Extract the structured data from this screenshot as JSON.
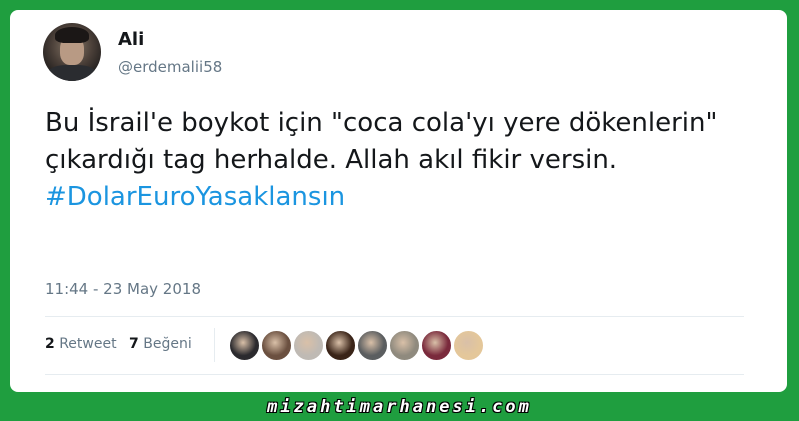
{
  "tweet": {
    "display_name": "Ali",
    "handle": "@erdemalii58",
    "text": "Bu İsrail'e boykot için \"coca cola'yı yere dökenlerin\" çıkardığı tag herhalde. Allah akıl fikir versin.",
    "hashtag": "#DolarEuroYasaklansın",
    "timestamp": "11:44 - 23 May 2018",
    "retweets": {
      "count": "2",
      "label": "Retweet"
    },
    "likes": {
      "count": "7",
      "label": "Beğeni"
    },
    "likers": [
      {
        "name": "liker-1",
        "color": "#2b2a2e"
      },
      {
        "name": "liker-2",
        "color": "#6b5040"
      },
      {
        "name": "liker-3",
        "color": "#bfbab4"
      },
      {
        "name": "liker-4",
        "color": "#3a2418"
      },
      {
        "name": "liker-5",
        "color": "#5b5e60"
      },
      {
        "name": "liker-6",
        "color": "#8f8a7e"
      },
      {
        "name": "liker-7",
        "color": "#7a2a3c"
      },
      {
        "name": "liker-8",
        "color": "#e4c79a"
      }
    ]
  },
  "footer": {
    "watermark": "mizahtimarhanesi.com"
  },
  "colors": {
    "background": "#1f9e3f",
    "hashtag": "#1b95e0",
    "muted": "#657786"
  }
}
